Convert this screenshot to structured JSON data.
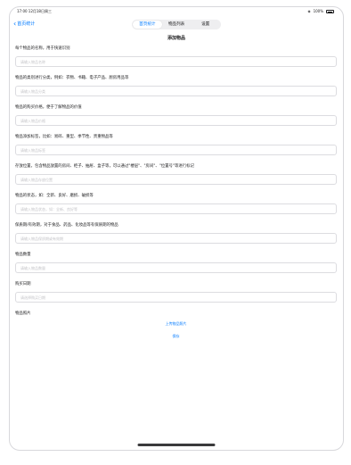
{
  "status_bar": {
    "time_date": "17:00  12月18日周三",
    "wifi_icon": "wifi-icon",
    "battery": "100%"
  },
  "nav": {
    "back_label": "首页统计",
    "tabs": [
      {
        "label": "首页统计",
        "active": true
      },
      {
        "label": "物品列表",
        "active": false
      },
      {
        "label": "设置",
        "active": false
      }
    ]
  },
  "form": {
    "title": "添加物品",
    "fields": [
      {
        "label": "每个物品的名称，用于快速识别",
        "placeholder": "请输入物品名称"
      },
      {
        "label": "物品的类别进行分类，例如：衣物、书籍、电子产品、厨房用品等",
        "placeholder": "请输入物品分类"
      },
      {
        "label": "物品的购买价格，便于了解物品的价值",
        "placeholder": "请输入物品价格"
      },
      {
        "label": "物品添加标签，比如：易碎、重型、季节性、贵重物品等",
        "placeholder": "请输入物品标签"
      },
      {
        "label": "存放位置，包含物品放置的房间、柜子、抽屉、盒子等，可以通过\"楼层\"、\"房间\"、\"位置号\"等进行标记",
        "placeholder": "请输入物品存放位置"
      },
      {
        "label": "物品的状态，如：全新、良好、磨损、破损等",
        "placeholder": "请输入物品状态，如：全新、良好等"
      },
      {
        "label": "保质期/有效期，对于食品、药品、化妆品等有保质期的物品",
        "placeholder": "请输入物品保质期或有效期"
      },
      {
        "label": "物品数量",
        "placeholder": "请输入物品数量"
      },
      {
        "label": "购买日期",
        "placeholder": "请选择购买日期"
      }
    ],
    "photo_label": "物品照片",
    "upload_label": "上传物品照片",
    "save_label": "保存"
  },
  "colors": {
    "accent": "#007aff",
    "border": "#dcdce0",
    "placeholder": "#c4c4c8"
  }
}
